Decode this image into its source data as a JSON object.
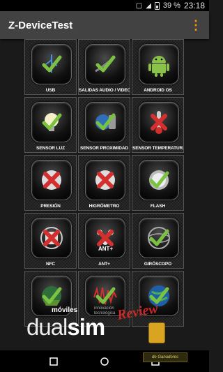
{
  "status": {
    "battery": "39 %",
    "time": "23:18"
  },
  "appbar": {
    "title": "Z-DeviceTest",
    "menu_icon": "overflow-menu-icon"
  },
  "tiles": [
    {
      "label": "USB",
      "icon": "usb-check-icon"
    },
    {
      "label": "SALIDAS AUDIO / VIDEO",
      "icon": "cable-check-icon"
    },
    {
      "label": "ANDROID OS",
      "icon": "android-icon"
    },
    {
      "label": "SENSOR LUZ",
      "icon": "lightbulb-check-icon"
    },
    {
      "label": "SENSOR PROXIMIDAD",
      "icon": "proximity-check-icon"
    },
    {
      "label": "SENSOR TEMPERATURA",
      "icon": "thermometer-x-icon"
    },
    {
      "label": "PRESIÓN",
      "icon": "pressure-x-icon"
    },
    {
      "label": "HIGRÓMETRO",
      "icon": "hygrometer-x-icon"
    },
    {
      "label": "FLASH",
      "icon": "flash-check-icon"
    },
    {
      "label": "NFC",
      "icon": "nfc-x-icon"
    },
    {
      "label": "ANT+",
      "icon": "ant-plus-x-icon"
    },
    {
      "label": "GIRÓSCOPO",
      "icon": "gyroscope-check-icon"
    },
    {
      "label": "",
      "icon": "gps-check-icon"
    },
    {
      "label": "",
      "icon": "signal-check-icon"
    },
    {
      "label": "",
      "icon": "globe-check-icon"
    }
  ],
  "watermark": {
    "moviles": "móviles",
    "brand_prefix": "dual",
    "brand_suffix": "sim",
    "review": "Review",
    "tagline": "innovación tecnológica",
    "signature": "de Ganadores"
  },
  "navbar": {
    "back_icon": "back-square-icon",
    "home_icon": "home-circle-icon",
    "recents_icon": "recents-square-icon"
  },
  "colors": {
    "appbar_bg": "#424242",
    "accent": "#ff9800",
    "check_green": "#7cc242",
    "cross_red": "#d32f2f"
  }
}
